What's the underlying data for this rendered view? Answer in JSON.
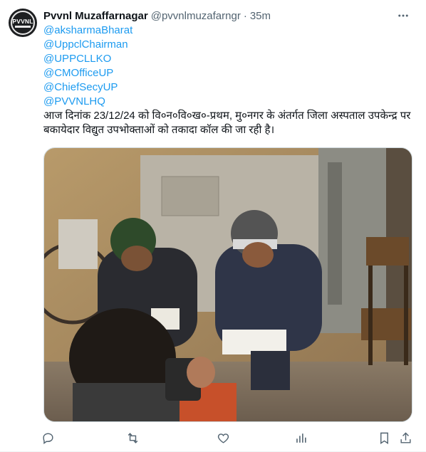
{
  "tweet": {
    "author": {
      "name": "Pvvnl Muzaffarnagar",
      "handle": "@pvvnlmuzafarngr",
      "avatar_text": "PVVNL",
      "avatar_icon": "pvvnl-logo"
    },
    "separator": "·",
    "time": "35m",
    "mentions": [
      "@aksharmaBharat",
      "@UppclChairman",
      "@UPPCLLKO",
      "@CMOfficeUP",
      "@ChiefSecyUP",
      "@PVVNLHQ"
    ],
    "text": "आज दिनांक 23/12/24 को वि०न०वि०ख०-प्रथम, मु०नगर के अंतर्गत जिला अस्पताल उपकेन्द्र पर बकायेदार विद्युत उपभोक्ताओं को तकादा कॉल की जा रही है।",
    "media_icon": "photo-people-making-calls",
    "actions": [
      "reply-icon",
      "retweet-icon",
      "like-icon",
      "views-icon",
      "bookmark-icon",
      "share-icon"
    ]
  },
  "colors": {
    "link": "#1d9bf0",
    "text": "#0f1419",
    "secondary": "#536471",
    "border": "#cfd9de"
  }
}
